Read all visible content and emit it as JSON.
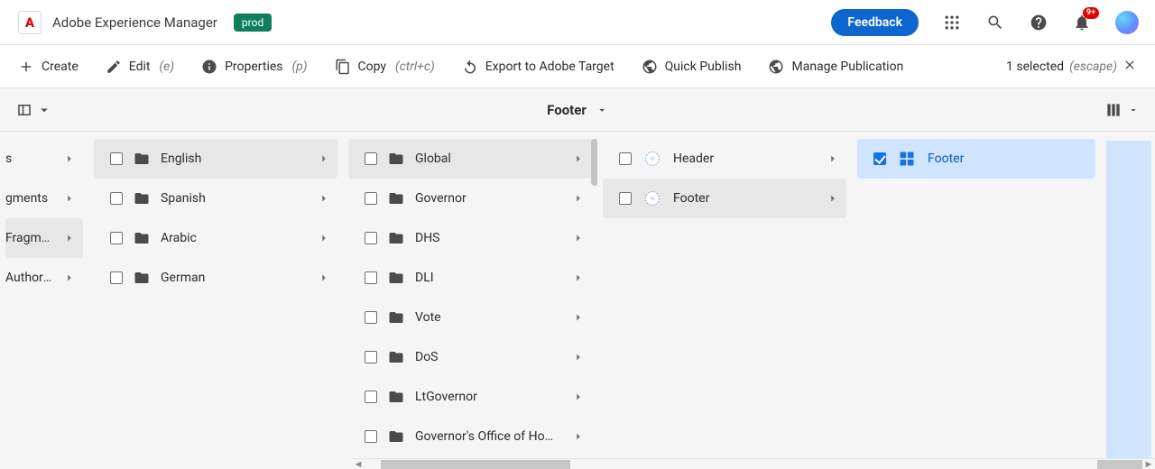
{
  "app": {
    "title": "Adobe Experience Manager",
    "env_badge": "prod"
  },
  "topbar": {
    "feedback": "Feedback",
    "notification_badge": "9+"
  },
  "actions": {
    "create": "Create",
    "edit": "Edit",
    "edit_hint": "(e)",
    "properties": "Properties",
    "properties_hint": "(p)",
    "copy": "Copy",
    "copy_hint": "(ctrl+c)",
    "export": "Export to Adobe Target",
    "quick_publish": "Quick Publish",
    "manage_publication": "Manage Publication",
    "selected_count": "1 selected",
    "escape_hint": "(escape)"
  },
  "subbar": {
    "title": "Footer"
  },
  "columns": {
    "col0": [
      {
        "label": "s"
      },
      {
        "label": "gments"
      },
      {
        "label": "Fragments",
        "selected_path": true
      },
      {
        "label": "Author Guid…"
      }
    ],
    "col1": [
      {
        "label": "English",
        "type": "folder",
        "selected_path": true
      },
      {
        "label": "Spanish",
        "type": "folder"
      },
      {
        "label": "Arabic",
        "type": "folder"
      },
      {
        "label": "German",
        "type": "folder"
      }
    ],
    "col2": [
      {
        "label": "Global",
        "type": "folder",
        "selected_path": true
      },
      {
        "label": "Governor",
        "type": "folder"
      },
      {
        "label": "DHS",
        "type": "folder"
      },
      {
        "label": "DLI",
        "type": "folder"
      },
      {
        "label": "Vote",
        "type": "folder"
      },
      {
        "label": "DoS",
        "type": "folder"
      },
      {
        "label": "LtGovernor",
        "type": "folder"
      },
      {
        "label": "Governor's Office of Homelan…",
        "type": "folder"
      }
    ],
    "col3": [
      {
        "label": "Header",
        "type": "fragment"
      },
      {
        "label": "Footer",
        "type": "fragment",
        "selected_path": true
      }
    ],
    "col4": [
      {
        "label": "Footer",
        "type": "fragment-blue",
        "checked": true,
        "selected_active": true
      }
    ]
  }
}
